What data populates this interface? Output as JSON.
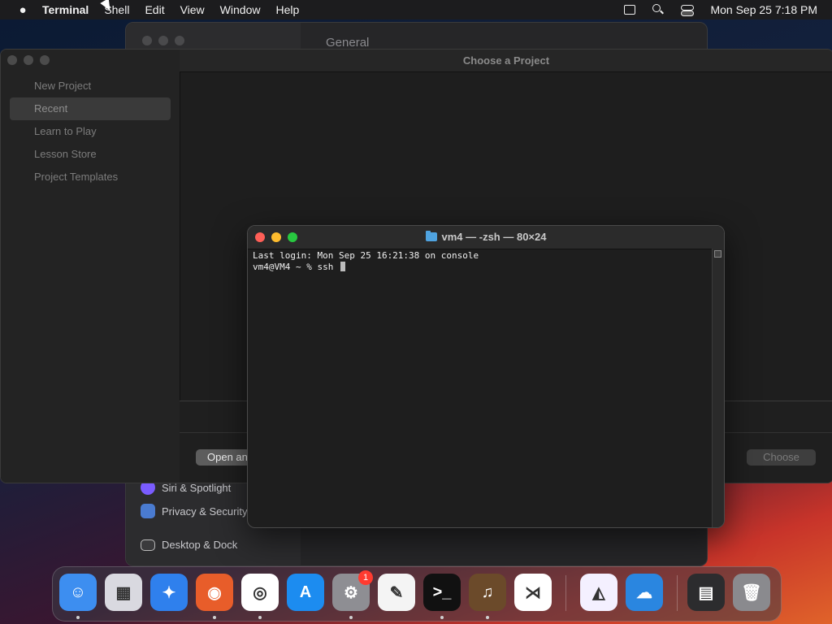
{
  "menubar": {
    "app_name": "Terminal",
    "menus": [
      "Shell",
      "Edit",
      "View",
      "Window",
      "Help"
    ],
    "clock": "Mon Sep 25  7:18 PM"
  },
  "settings_window": {
    "section_title": "General",
    "sidebar_items": [
      {
        "label": "Siri & Spotlight",
        "icon": "siri-icon",
        "color": "#7a5cff"
      },
      {
        "label": "Privacy & Security",
        "icon": "hand-icon",
        "color": "#4a7bd0"
      },
      {
        "label": "Desktop & Dock",
        "icon": "dock-icon",
        "color": "#3a3a3c"
      }
    ]
  },
  "garageband_window": {
    "title": "Choose a Project",
    "nav": [
      {
        "label": "New Project",
        "selected": false
      },
      {
        "label": "Recent",
        "selected": true
      },
      {
        "label": "Learn to Play",
        "selected": false
      },
      {
        "label": "Lesson Store",
        "selected": false
      },
      {
        "label": "Project Templates",
        "selected": false
      }
    ],
    "open_button": "Open an",
    "choose_button": "Choose"
  },
  "terminal": {
    "title": "vm4 — -zsh — 80×24",
    "lines": [
      "Last login: Mon Sep 25 16:21:38 on console",
      "vm4@VM4 ~ % ssh "
    ]
  },
  "dock": {
    "apps": [
      {
        "name": "finder-icon",
        "color": "#3d8ef0",
        "glyph": "☺",
        "running": true
      },
      {
        "name": "launchpad-icon",
        "color": "#d9d9e0",
        "glyph": "▦",
        "running": false
      },
      {
        "name": "safari-icon",
        "color": "#2f80ed",
        "glyph": "✦",
        "running": false
      },
      {
        "name": "firefox-icon",
        "color": "#e85d2a",
        "glyph": "◉",
        "running": true
      },
      {
        "name": "chrome-icon",
        "color": "#ffffff",
        "glyph": "◎",
        "running": true
      },
      {
        "name": "app-store-icon",
        "color": "#1c8cf0",
        "glyph": "A",
        "running": false
      },
      {
        "name": "system-settings-icon",
        "color": "#8e8e93",
        "glyph": "⚙",
        "running": true,
        "badge": "1"
      },
      {
        "name": "textedit-icon",
        "color": "#f4f4f4",
        "glyph": "✎",
        "running": false
      },
      {
        "name": "terminal-icon",
        "color": "#111111",
        "glyph": ">_",
        "running": true
      },
      {
        "name": "garageband-icon",
        "color": "#6b4a2a",
        "glyph": "♫",
        "running": true
      },
      {
        "name": "vscode-icon",
        "color": "#ffffff",
        "glyph": "⋊",
        "running": false
      },
      {
        "name": "visual-studio-icon",
        "color": "#f4f0ff",
        "glyph": "◭",
        "running": false
      },
      {
        "name": "weather-icon",
        "color": "#2a86e0",
        "glyph": "☁",
        "running": false
      },
      {
        "name": "downloads-stack-icon",
        "color": "#2c2c2e",
        "glyph": "▤",
        "running": false
      },
      {
        "name": "trash-icon",
        "color": "#8a8a8e",
        "glyph": "🗑",
        "running": false
      }
    ]
  }
}
